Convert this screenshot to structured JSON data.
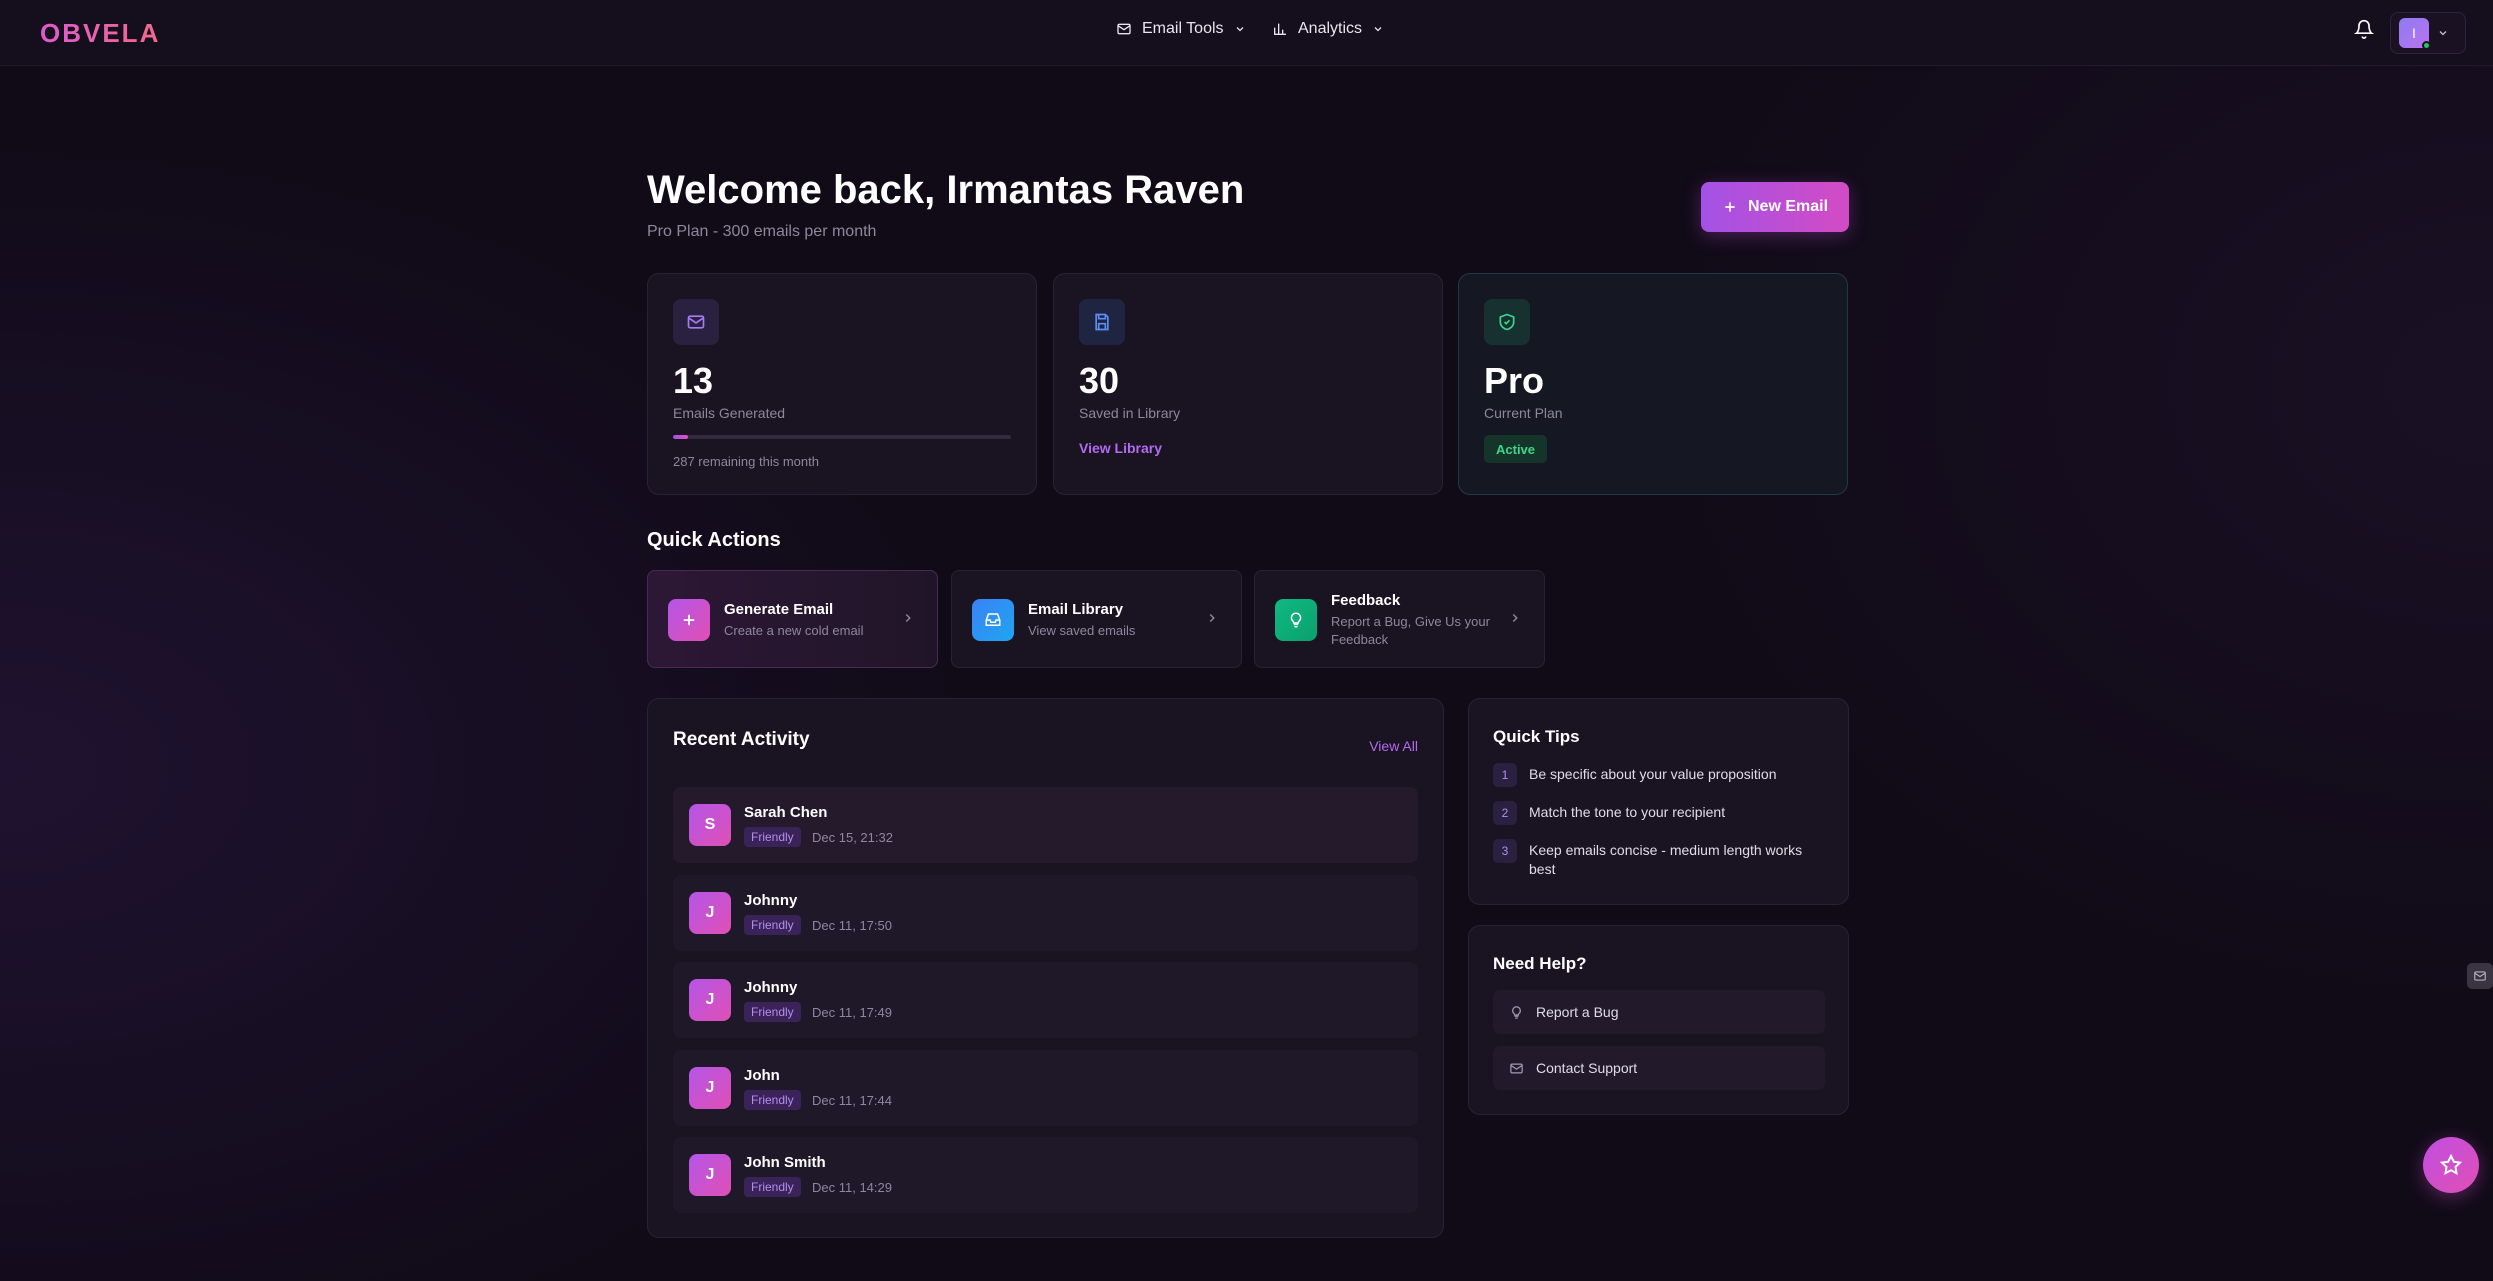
{
  "header": {
    "logo": "OBVELA",
    "nav": [
      {
        "label": "Email Tools",
        "icon": "mail-icon"
      },
      {
        "label": "Analytics",
        "icon": "bar-chart-icon"
      }
    ],
    "user_initial": "I"
  },
  "welcome": {
    "title": "Welcome back, Irmantas Raven",
    "subtitle": "Pro Plan - 300 emails per month",
    "new_email_label": "New Email"
  },
  "stats": [
    {
      "value": "13",
      "label": "Emails Generated",
      "progress": 0.043,
      "footer": "287 remaining this month",
      "icon": "mail-icon"
    },
    {
      "value": "30",
      "label": "Saved in Library",
      "link": "View Library",
      "icon": "save-icon"
    },
    {
      "value": "Pro",
      "label": "Current Plan",
      "badge": "Active",
      "icon": "shield-check-icon"
    }
  ],
  "quick_actions": {
    "title": "Quick Actions",
    "items": [
      {
        "name": "Generate Email",
        "desc": "Create a new cold email",
        "icon": "plus-icon"
      },
      {
        "name": "Email Library",
        "desc": "View saved emails",
        "icon": "archive-icon"
      },
      {
        "name": "Feedback",
        "desc": "Report a Bug, Give Us your Feedback",
        "icon": "lightbulb-icon"
      }
    ]
  },
  "recent": {
    "title": "Recent Activity",
    "view_all": "View All",
    "items": [
      {
        "initial": "S",
        "name": "Sarah Chen",
        "tag": "Friendly",
        "time": "Dec 15, 21:32"
      },
      {
        "initial": "J",
        "name": "Johnny",
        "tag": "Friendly",
        "time": "Dec 11, 17:50"
      },
      {
        "initial": "J",
        "name": "Johnny",
        "tag": "Friendly",
        "time": "Dec 11, 17:49"
      },
      {
        "initial": "J",
        "name": "John",
        "tag": "Friendly",
        "time": "Dec 11, 17:44"
      },
      {
        "initial": "J",
        "name": "John Smith",
        "tag": "Friendly",
        "time": "Dec 11, 14:29"
      }
    ]
  },
  "tips": {
    "title": "Quick Tips",
    "items": [
      {
        "num": "1",
        "text": "Be specific about your value proposition"
      },
      {
        "num": "2",
        "text": "Match the tone to your recipient"
      },
      {
        "num": "3",
        "text": "Keep emails concise - medium length works best"
      }
    ]
  },
  "help": {
    "title": "Need Help?",
    "items": [
      {
        "label": "Report a Bug",
        "icon": "lightbulb-icon"
      },
      {
        "label": "Contact Support",
        "icon": "mail-icon"
      }
    ]
  },
  "colors": {
    "accent": "#a352e6",
    "accent2": "#e04fb5",
    "success": "#3ed58a",
    "background": "#110b18"
  }
}
